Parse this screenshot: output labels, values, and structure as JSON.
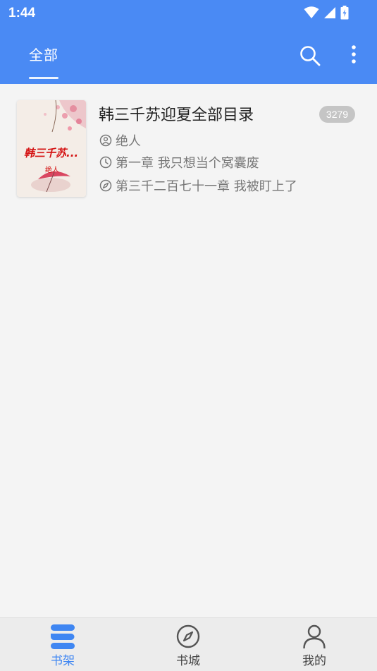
{
  "status_bar": {
    "time": "1:44"
  },
  "toolbar": {
    "tab_label": "全部",
    "search_icon": "search-icon",
    "more_icon": "more-vertical-icon"
  },
  "books": [
    {
      "title": "韩三千苏迎夏全部目录",
      "author": "绝人",
      "last_read": "第一章 我只想当个窝囊废",
      "latest_chapter": "第三千二百七十一章 我被盯上了",
      "unread_count": "3279",
      "cover": {
        "title": "韩三千苏...",
        "author": "绝人"
      }
    }
  ],
  "bottom_nav": {
    "shelf": "书架",
    "store": "书城",
    "mine": "我的"
  },
  "colors": {
    "primary": "#4a8af4",
    "active_tab": "#3f86f2",
    "background": "#f4f4f4",
    "badge": "#c5c5c5",
    "cover_title": "#d41212"
  }
}
